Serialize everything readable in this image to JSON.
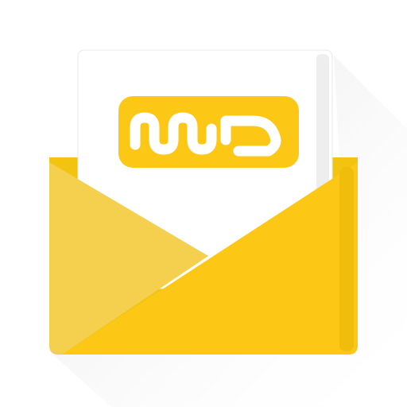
{
  "icon": {
    "name": "mail-envelope-app-icon",
    "logo_lettering": "md",
    "colors": {
      "background": "#ffffff",
      "paper": "#ffffff",
      "paper_edge": "#e6e6e6",
      "envelope_back": "#f2c40f",
      "envelope_left_flap": "#f5cf4e",
      "envelope_front": "#fdc715",
      "envelope_edge": "#eab80d",
      "logo": "#fdc715",
      "logo_cutout": "#ffffff",
      "long_shadow": "#d9d9d9"
    }
  }
}
